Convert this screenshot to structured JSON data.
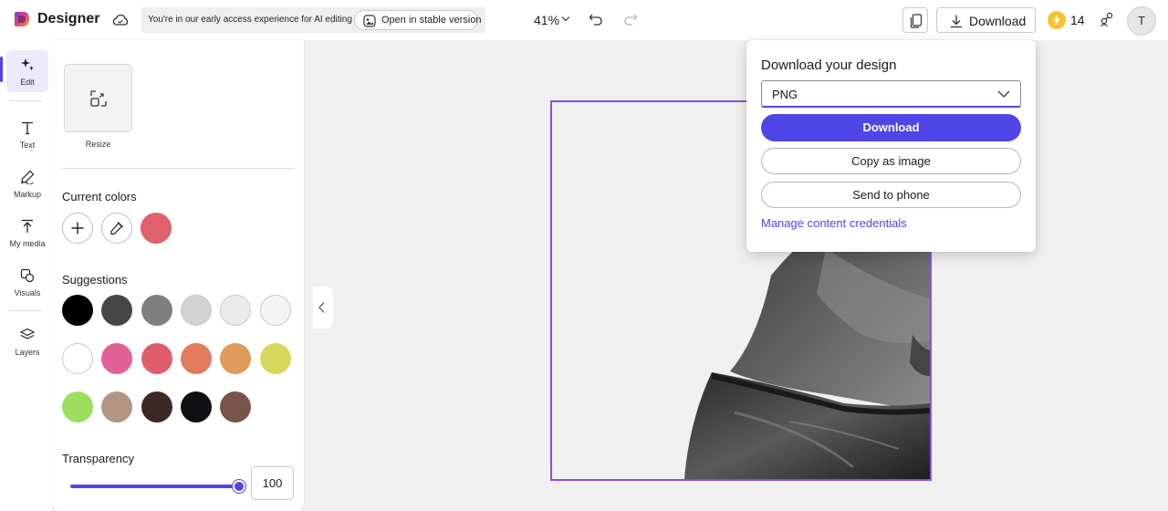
{
  "app": {
    "name": "Designer"
  },
  "header": {
    "notice": "You're in our early access experience for AI editing",
    "stable_button": "Open in stable version",
    "zoom": "41%",
    "download_label": "Download",
    "credits": "14",
    "avatar_initial": "T"
  },
  "rail": {
    "items": [
      {
        "label": "Edit",
        "icon": "magic-edit-icon"
      },
      {
        "label": "Text",
        "icon": "text-icon"
      },
      {
        "label": "Markup",
        "icon": "pen-icon"
      },
      {
        "label": "My media",
        "icon": "upload-icon"
      },
      {
        "label": "Visuals",
        "icon": "shapes-icon"
      },
      {
        "label": "Layers",
        "icon": "layers-icon"
      }
    ]
  },
  "panel": {
    "resize_label": "Resize",
    "current_colors_title": "Current colors",
    "current_colors": [
      "#e0606c"
    ],
    "suggestions_title": "Suggestions",
    "suggestions": [
      "#000000",
      "#464646",
      "#7f7f7f",
      "#d2d2d2",
      "#ebebeb",
      "#f3f3f3",
      "#ffffff",
      "#e06197",
      "#e05d6c",
      "#e27a5e",
      "#e09a5c",
      "#d6d85c",
      "#9ddf5d",
      "#b29583",
      "#3c2924",
      "#0e1014",
      "#775548"
    ],
    "transparency_title": "Transparency",
    "transparency_value": "100",
    "transparency_fraction": 1.0
  },
  "popup": {
    "title": "Download your design",
    "format": "PNG",
    "download_button": "Download",
    "copy_button": "Copy as image",
    "phone_button": "Send to phone",
    "credentials_link": "Manage content credentials"
  },
  "colors": {
    "accent": "#4f46e5",
    "selection": "#8a4de8"
  }
}
